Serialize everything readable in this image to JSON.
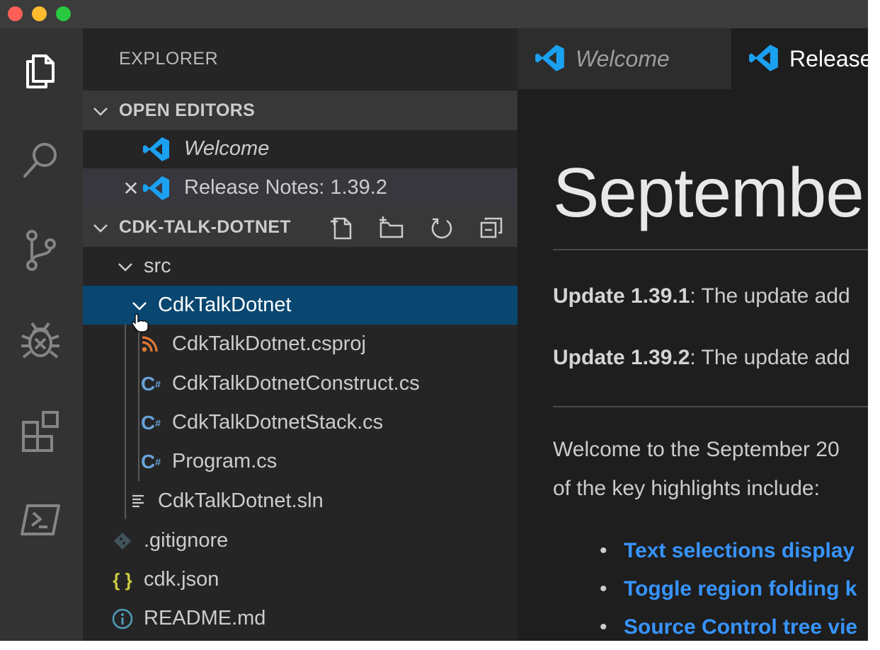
{
  "explorer": {
    "title": "EXPLORER",
    "open_editors_label": "OPEN EDITORS",
    "open_editors": [
      {
        "name": "Welcome",
        "icon": "vscode-icon",
        "italic": true
      },
      {
        "name": "Release Notes: 1.39.2",
        "icon": "vscode-icon",
        "close": "✕"
      }
    ],
    "project_label": "CDK-TALK-DOTNET",
    "project_tools": [
      "new-file-icon",
      "new-folder-icon",
      "refresh-icon",
      "collapse-all-icon"
    ],
    "tree": [
      {
        "name": "src",
        "icon": "chevron-down-icon"
      },
      {
        "name": "CdkTalkDotnet",
        "icon": "chevron-down-icon",
        "selected": true
      },
      {
        "name": "CdkTalkDotnet.csproj",
        "icon": "rss-icon"
      },
      {
        "name": "CdkTalkDotnetConstruct.cs",
        "icon": "csharp-icon"
      },
      {
        "name": "CdkTalkDotnetStack.cs",
        "icon": "csharp-icon"
      },
      {
        "name": "Program.cs",
        "icon": "csharp-icon"
      },
      {
        "name": "CdkTalkDotnet.sln",
        "icon": "lines-icon"
      },
      {
        "name": ".gitignore",
        "icon": "git-icon"
      },
      {
        "name": "cdk.json",
        "icon": "braces-icon"
      },
      {
        "name": "README.md",
        "icon": "info-icon"
      }
    ]
  },
  "activity_bar": [
    "files-icon",
    "search-icon",
    "source-control-icon",
    "debug-icon",
    "extensions-icon",
    "terminal-icon"
  ],
  "tabs": [
    {
      "label": "Welcome",
      "active": false
    },
    {
      "label": "Release",
      "active": true
    }
  ],
  "content": {
    "heading": "September",
    "update1_label": "Update 1.39.1",
    "update1_text": ": The update add",
    "update2_label": "Update 1.39.2",
    "update2_text": ": The update add",
    "welcome_line1": "Welcome to the September 20",
    "welcome_line2": "of the key highlights include:",
    "highlights": [
      "Text selections display",
      "Toggle region folding k",
      "Source Control tree vie"
    ]
  },
  "colors": {
    "selection": "#094771",
    "link": "#3794ff",
    "csharp": "#68a2d8",
    "rss": "#e37933",
    "json": "#cbcb41",
    "vscode_blue": "#1ba1f2"
  }
}
